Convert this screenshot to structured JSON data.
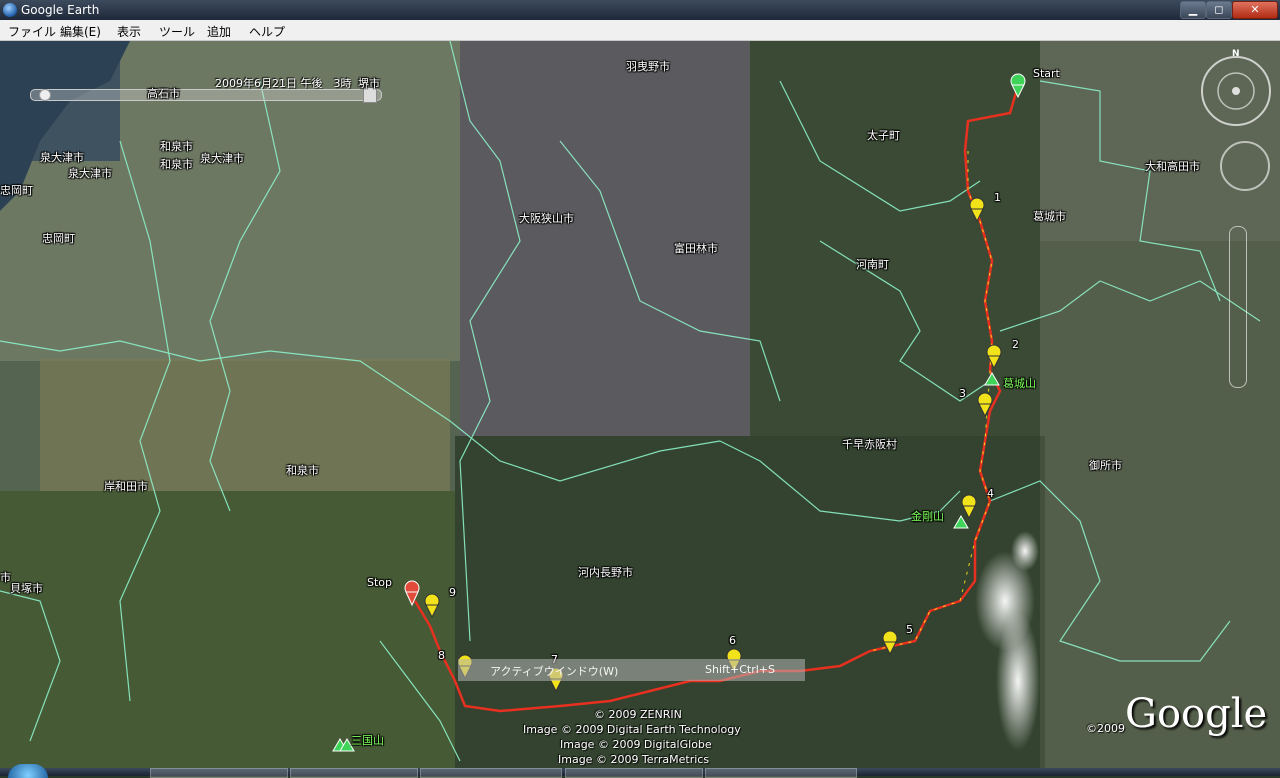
{
  "window": {
    "title": "Google Earth",
    "buttons": {
      "minimize": "▁",
      "maximize": "◻",
      "close": "✕"
    }
  },
  "menubar": {
    "items": [
      "ファイル",
      "編集(E)",
      "表示",
      "ツール",
      "追加",
      "ヘルプ"
    ]
  },
  "time": {
    "label": "2009年6月21日 午後　3時"
  },
  "map_labels": {
    "cities": [
      "堺市",
      "羽曳野市",
      "高石市",
      "和泉市",
      "和泉市",
      "泉大津市",
      "泉大津市",
      "泉大津市",
      "忠岡町",
      "忠岡町",
      "太子町",
      "大和高田市",
      "葛城市",
      "大阪狭山市",
      "富田林市",
      "河南町",
      "千早赤阪村",
      "御所市",
      "和泉市",
      "岸和田市",
      "河内長野市",
      "市",
      "貝塚市"
    ],
    "mountains": [
      "葛城山",
      "金剛山",
      "三国山"
    ]
  },
  "waypoints": {
    "start": "Start",
    "stop": "Stop",
    "numbers": [
      "1",
      "2",
      "3",
      "4",
      "5",
      "6",
      "7",
      "8",
      "9"
    ]
  },
  "overlay": {
    "menu_text": "アクティブウインドウ(W)",
    "shortcut": "Shift+Ctrl+S"
  },
  "copyright": [
    "© 2009 ZENRIN",
    "Image © 2009 Digital Earth Technology",
    "Image © 2009 DigitalGlobe",
    "Image © 2009 TerraMetrics"
  ],
  "brand": {
    "year": "©2009",
    "logo": "Google"
  },
  "nav": {
    "north": "N"
  },
  "colors": {
    "track": "#e83020",
    "boundary": "#8cf0c8",
    "pin_yellow": "#f2e21a",
    "pin_green": "#3fd35a",
    "pin_red": "#e24a3a"
  }
}
